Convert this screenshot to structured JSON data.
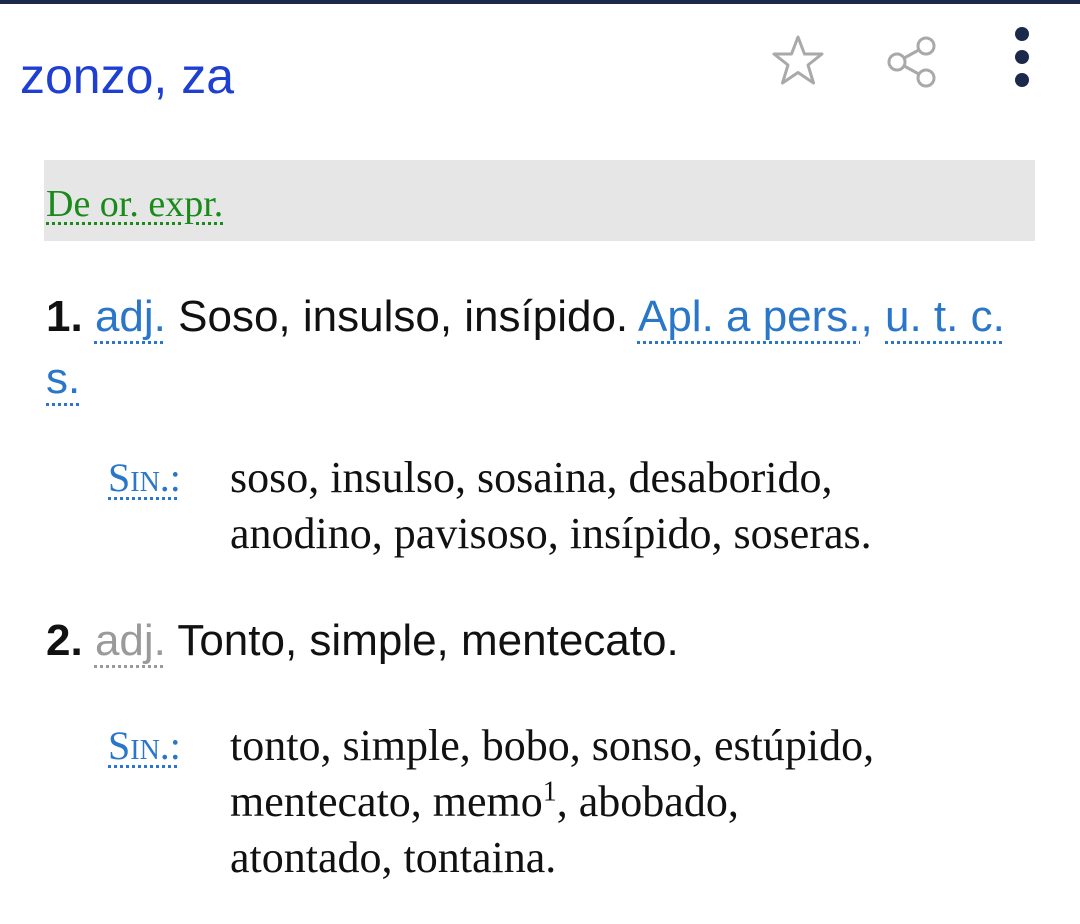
{
  "header": {
    "title": "zonzo, za",
    "icons": {
      "favorite": "star-outline-icon",
      "share": "share-icon",
      "more": "more-vert-icon"
    },
    "title_color": "#1f3fd1"
  },
  "etymology": {
    "text": "De or. expr."
  },
  "definitions": [
    {
      "number": "1.",
      "pos": "adj.",
      "text": "Soso, insulso, insípido.",
      "note_1": "Apl. a pers.",
      "note_sep": ",",
      "note_2": "u. t. c. s."
    },
    {
      "number": "2.",
      "pos": "adj.",
      "text": "Tonto, simple, mentecato."
    }
  ],
  "synonyms": [
    {
      "label": "Sin.:",
      "line_1": "soso, insulso, sosaina, desaborido,",
      "line_2": "anodino, pavisoso, insípido, soseras."
    },
    {
      "label": "Sin.:",
      "line_1": "tonto, simple, bobo, sonso, estúpido,",
      "line_2_a": "mentecato, memo",
      "line_2_sup": "1",
      "line_2_b": ", abobado,",
      "line_3": "atontado, tontaina."
    }
  ],
  "colors": {
    "link_blue": "#2a76c8",
    "etym_green": "#1a8a1a",
    "gray_abbr": "#9a9a9a",
    "etym_background": "#e6e6e6"
  }
}
